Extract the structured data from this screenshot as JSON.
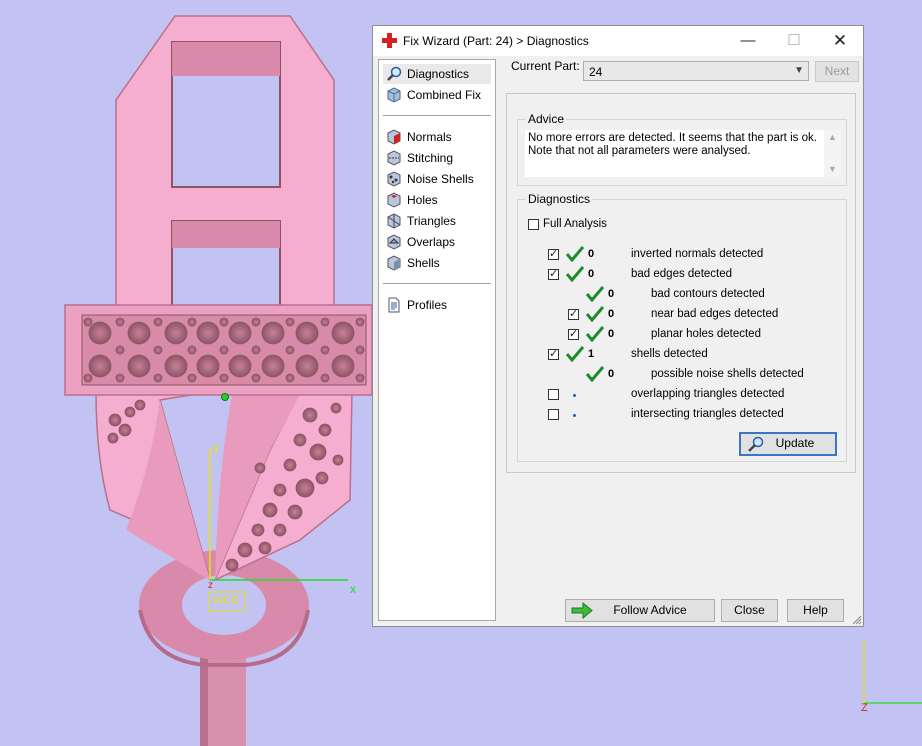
{
  "viewport": {
    "axis_x_label": "x",
    "axis_y_label": "y",
    "axis_z_label": "z",
    "wcs_label": "WCS",
    "corner_z_label": "Z",
    "colors": {
      "background": "#c2c3f2",
      "part": "#f6aed0",
      "part_shadow": "#d88aa9",
      "axis_x": "#22dd22",
      "axis_y": "#e6e600"
    }
  },
  "dialog": {
    "title": "Fix Wizard (Part: 24) > Diagnostics",
    "title_icon": "red-cross-icon",
    "nav": {
      "items_top": [
        {
          "label": "Diagnostics",
          "icon": "magnifier-icon",
          "selected": true
        },
        {
          "label": "Combined Fix",
          "icon": "cube-icon"
        }
      ],
      "items_mid": [
        {
          "label": "Normals",
          "icon": "normals-icon"
        },
        {
          "label": "Stitching",
          "icon": "stitching-icon"
        },
        {
          "label": "Noise Shells",
          "icon": "noise-shells-icon"
        },
        {
          "label": "Holes",
          "icon": "holes-icon"
        },
        {
          "label": "Triangles",
          "icon": "triangles-icon"
        },
        {
          "label": "Overlaps",
          "icon": "overlaps-icon"
        },
        {
          "label": "Shells",
          "icon": "shells-icon"
        }
      ],
      "items_bottom": [
        {
          "label": "Profiles",
          "icon": "document-icon"
        }
      ]
    },
    "current_part_label": "Current Part:",
    "current_part_value": "24",
    "next_label": "Next",
    "advice": {
      "title": "Advice",
      "line1": "No more errors are detected. It seems that the part is ok.",
      "line2": "Note that not all parameters were analysed."
    },
    "diagnostics": {
      "title": "Diagnostics",
      "full_analysis_label": "Full Analysis",
      "rows": [
        {
          "checked": true,
          "status": "ok",
          "count": "0",
          "label": "inverted normals detected"
        },
        {
          "checked": true,
          "status": "ok",
          "count": "0",
          "label": "bad edges detected"
        },
        {
          "checked": null,
          "status": "ok",
          "count": "0",
          "label": "bad contours detected"
        },
        {
          "checked": true,
          "status": "ok",
          "count": "0",
          "label": "near bad edges detected"
        },
        {
          "checked": true,
          "status": "ok",
          "count": "0",
          "label": "planar holes detected"
        },
        {
          "checked": true,
          "status": "ok",
          "count": "1",
          "label": "shells detected"
        },
        {
          "checked": null,
          "status": "ok",
          "count": "0",
          "label": "possible noise shells detected"
        },
        {
          "checked": false,
          "status": "pending",
          "count": "",
          "label": "overlapping triangles detected"
        },
        {
          "checked": false,
          "status": "pending",
          "count": "",
          "label": "intersecting triangles detected"
        }
      ],
      "update_label": "Update"
    },
    "buttons": {
      "follow_advice": "Follow Advice",
      "close": "Close",
      "help": "Help"
    }
  }
}
